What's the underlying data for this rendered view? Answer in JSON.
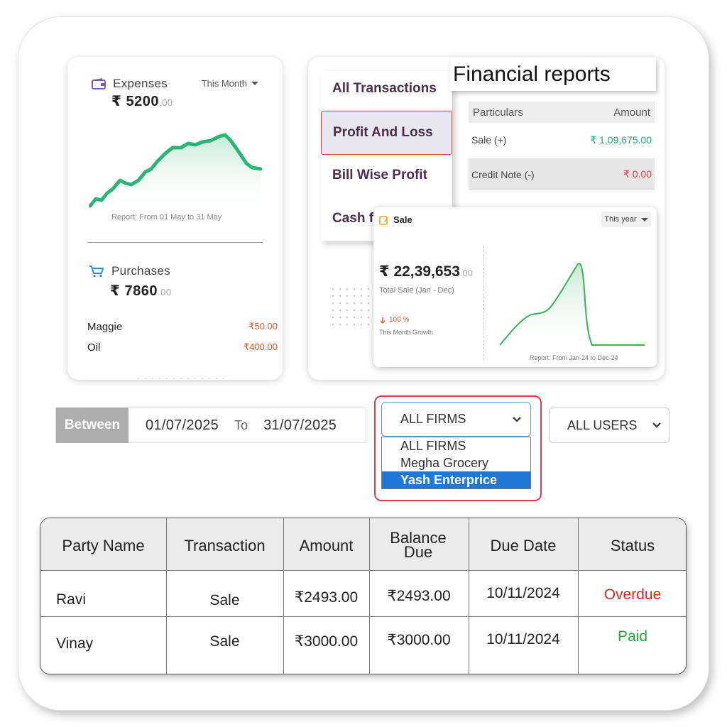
{
  "expenses": {
    "label": "Expenses",
    "period": "This Month",
    "amount": "₹ 5200",
    "amount_decimal": ".00",
    "report": "Report: From 01 May to 31 May",
    "accent_color": "#2db37a"
  },
  "purchases": {
    "label": "Purchases",
    "amount": "₹ 7860",
    "amount_decimal": ".00",
    "items": [
      {
        "name": "Maggie",
        "price": "₹50.00"
      },
      {
        "name": "Oil",
        "price": "₹400.00"
      }
    ]
  },
  "financial_reports": {
    "title": "Financial reports",
    "menu": [
      "All Transactions",
      "Profit And Loss",
      "Bill Wise Profit",
      "Cash fl"
    ],
    "active_menu": "Profit And Loss",
    "table_headers": {
      "particulars": "Particulars",
      "amount": "Amount"
    },
    "rows": [
      {
        "particular": "Sale (+)",
        "amount": "₹ 1,09,675.00"
      },
      {
        "particular": "Credit Note (-)",
        "amount": "₹ 0.00"
      }
    ]
  },
  "sale": {
    "title": "Sale",
    "period": "This year",
    "amount": "₹ 22,39,653",
    "amount_decimal": ".00",
    "subtitle": "Total Sale (Jan - Dec)",
    "growth": "100 %",
    "growth_label": "This Month Growth",
    "report": "Report: From Jan-24 to Dec-24"
  },
  "filters": {
    "between_label": "Between",
    "from_date": "01/07/2025",
    "to_label": "To",
    "to_date": "31/07/2025",
    "firm_selected": "ALL FIRMS",
    "firm_options": [
      "ALL FIRMS",
      "Megha Grocery",
      "Yash Enterprice"
    ],
    "firm_highlighted": "Yash Enterprice",
    "user_selected": "ALL USERS"
  },
  "table": {
    "headers": [
      "Party Name",
      "Transaction",
      "Amount",
      "Balance Due",
      "Due Date",
      "Status"
    ],
    "rows": [
      {
        "party": "Ravi",
        "transaction": "Sale",
        "amount": "₹2493.00",
        "balance": "₹2493.00",
        "due_date": "10/11/2024",
        "status": "Overdue"
      },
      {
        "party": "Vinay",
        "transaction": "Sale",
        "amount": "₹3000.00",
        "balance": "₹3000.00",
        "due_date": "10/11/2024",
        "status": "Paid"
      }
    ],
    "status_colors": {
      "Overdue": "#d9261c",
      "Paid": "#22a845"
    }
  }
}
